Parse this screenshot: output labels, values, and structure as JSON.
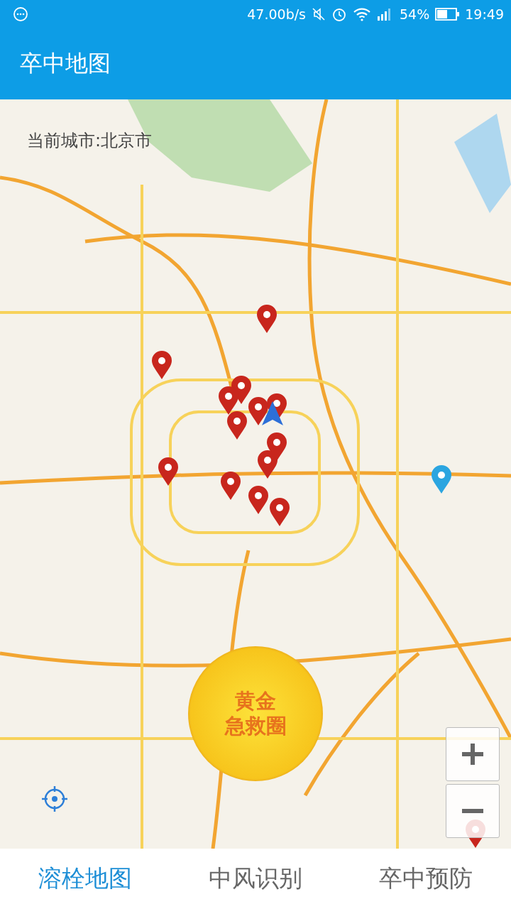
{
  "status_bar": {
    "speed": "47.00b/s",
    "battery": "54%",
    "time": "19:49"
  },
  "app_bar": {
    "title": "卒中地图"
  },
  "map": {
    "current_city": "当前城市:北京市",
    "rescue_button": {
      "lines": [
        "黄金",
        "急救圈"
      ]
    }
  },
  "tabs": [
    {
      "label": "溶栓地图",
      "selected": true
    },
    {
      "label": "中风识别",
      "selected": false
    },
    {
      "label": "卒中预防",
      "selected": false
    }
  ]
}
